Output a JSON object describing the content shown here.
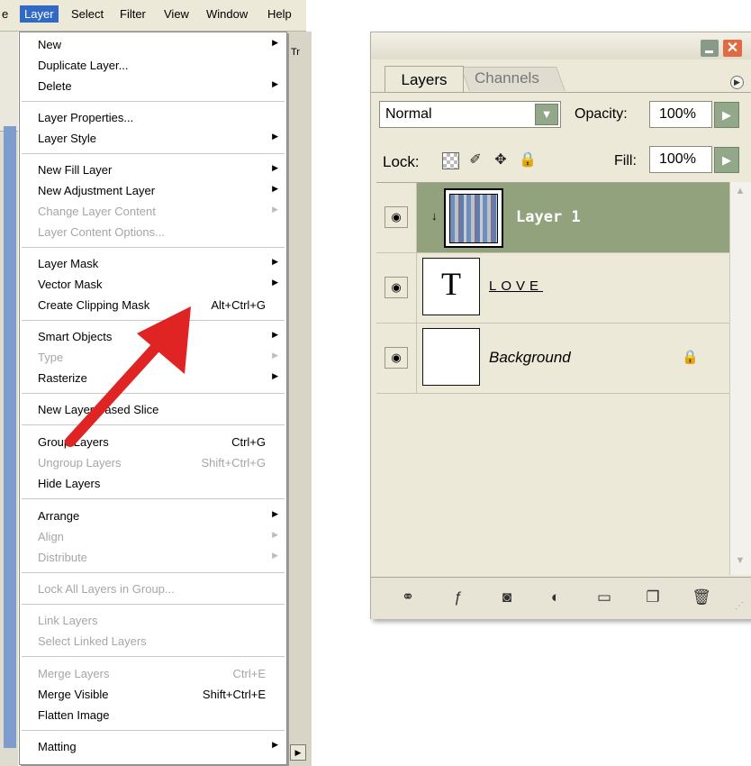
{
  "menubar": {
    "items": [
      "e",
      "Layer",
      "Select",
      "Filter",
      "View",
      "Window",
      "Help"
    ]
  },
  "toolbar_right": {
    "tr_label": "Tr"
  },
  "layer_menu": {
    "items": [
      {
        "label": "New",
        "shortcut": "",
        "submenu": true,
        "disabled": false
      },
      {
        "label": "Duplicate Layer...",
        "shortcut": "",
        "submenu": false,
        "disabled": false
      },
      {
        "label": "Delete",
        "shortcut": "",
        "submenu": true,
        "disabled": false
      },
      {
        "label": "Layer Properties...",
        "shortcut": "",
        "submenu": false,
        "disabled": false
      },
      {
        "label": "Layer Style",
        "shortcut": "",
        "submenu": true,
        "disabled": false
      },
      {
        "label": "New Fill Layer",
        "shortcut": "",
        "submenu": true,
        "disabled": false
      },
      {
        "label": "New Adjustment Layer",
        "shortcut": "",
        "submenu": true,
        "disabled": false
      },
      {
        "label": "Change Layer Content",
        "shortcut": "",
        "submenu": true,
        "disabled": true
      },
      {
        "label": "Layer Content Options...",
        "shortcut": "",
        "submenu": false,
        "disabled": true
      },
      {
        "label": "Layer Mask",
        "shortcut": "",
        "submenu": true,
        "disabled": false
      },
      {
        "label": "Vector Mask",
        "shortcut": "",
        "submenu": true,
        "disabled": false
      },
      {
        "label": "Create Clipping Mask",
        "shortcut": "Alt+Ctrl+G",
        "submenu": false,
        "disabled": false
      },
      {
        "label": "Smart Objects",
        "shortcut": "",
        "submenu": true,
        "disabled": false
      },
      {
        "label": "Type",
        "shortcut": "",
        "submenu": true,
        "disabled": true
      },
      {
        "label": "Rasterize",
        "shortcut": "",
        "submenu": true,
        "disabled": false
      },
      {
        "label": "New Layer Based Slice",
        "shortcut": "",
        "submenu": false,
        "disabled": false
      },
      {
        "label": "Group Layers",
        "shortcut": "Ctrl+G",
        "submenu": false,
        "disabled": false
      },
      {
        "label": "Ungroup Layers",
        "shortcut": "Shift+Ctrl+G",
        "submenu": false,
        "disabled": true
      },
      {
        "label": "Hide Layers",
        "shortcut": "",
        "submenu": false,
        "disabled": false
      },
      {
        "label": "Arrange",
        "shortcut": "",
        "submenu": true,
        "disabled": false
      },
      {
        "label": "Align",
        "shortcut": "",
        "submenu": true,
        "disabled": true
      },
      {
        "label": "Distribute",
        "shortcut": "",
        "submenu": true,
        "disabled": true
      },
      {
        "label": "Lock All Layers in Group...",
        "shortcut": "",
        "submenu": false,
        "disabled": true
      },
      {
        "label": "Link Layers",
        "shortcut": "",
        "submenu": false,
        "disabled": true
      },
      {
        "label": "Select Linked Layers",
        "shortcut": "",
        "submenu": false,
        "disabled": true
      },
      {
        "label": "Merge Layers",
        "shortcut": "Ctrl+E",
        "submenu": false,
        "disabled": true
      },
      {
        "label": "Merge Visible",
        "shortcut": "Shift+Ctrl+E",
        "submenu": false,
        "disabled": false
      },
      {
        "label": "Flatten Image",
        "shortcut": "",
        "submenu": false,
        "disabled": false
      },
      {
        "label": "Matting",
        "shortcut": "",
        "submenu": true,
        "disabled": false
      }
    ]
  },
  "layers_panel": {
    "tabs": [
      "Layers",
      "Channels"
    ],
    "blend_mode": "Normal",
    "opacity_label": "Opacity:",
    "opacity_value": "100%",
    "lock_label": "Lock:",
    "fill_label": "Fill:",
    "fill_value": "100%",
    "layers": [
      {
        "name": "Layer 1",
        "selected": true,
        "visible": true
      },
      {
        "name": "LOVE",
        "selected": false,
        "visible": true
      },
      {
        "name": "Background",
        "selected": false,
        "visible": true
      }
    ]
  },
  "colors": {
    "menu_highlight": "#316ac5",
    "selected_layer": "#91a27c",
    "annotation_arrow": "#e02323"
  }
}
